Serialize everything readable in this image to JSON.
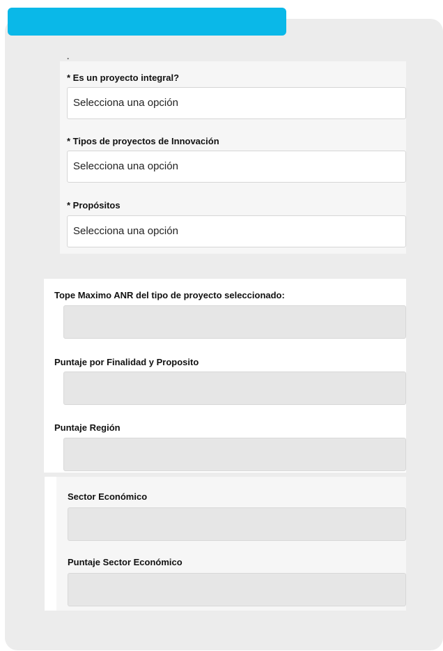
{
  "header": {
    "accent": "#0ab8e8"
  },
  "integral": {
    "label": "* Es un proyecto integral?",
    "value": "Selecciona una opción"
  },
  "innovation_types": {
    "label": "* Tipos de proyectos de Innovación",
    "value": "Selecciona una opción"
  },
  "purposes": {
    "label": "* Propósitos",
    "value": "Selecciona una opción"
  },
  "tope_anr": {
    "label": "Tope Maximo ANR del tipo de proyecto seleccionado:",
    "value": ""
  },
  "puntaje_finalidad": {
    "label": "Puntaje por Finalidad y Proposito",
    "value": ""
  },
  "puntaje_region": {
    "label": "Puntaje Región",
    "value": ""
  },
  "sector": {
    "label": "Sector Económico",
    "value": ""
  },
  "puntaje_sector": {
    "label": "Puntaje Sector Económico",
    "value": ""
  }
}
